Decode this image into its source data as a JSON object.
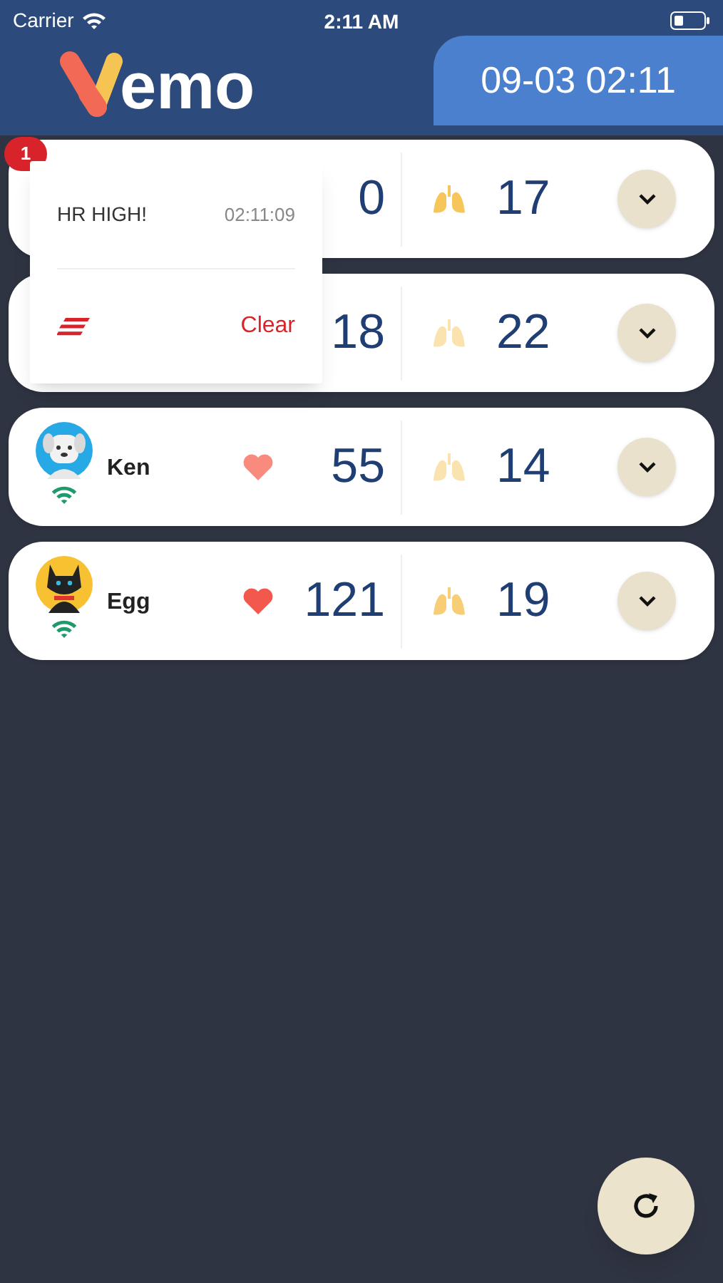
{
  "status_bar": {
    "carrier": "Carrier",
    "time": "2:11 AM"
  },
  "header": {
    "logo_text": "emo",
    "datetime": "09-03 02:11"
  },
  "patients": [
    {
      "hr": "0",
      "rr": "17",
      "lungs": {
        "color": "#f7c65a"
      }
    },
    {
      "hr": "18",
      "rr": "22",
      "lungs": {
        "color": "#fbe3b0"
      }
    },
    {
      "name": "Ken",
      "avatar": {
        "kind": "dog"
      },
      "hr": "55",
      "rr": "14",
      "heart": {
        "color": "#f98a7e"
      },
      "lungs": {
        "color": "#fbe3b0"
      }
    },
    {
      "name": "Egg",
      "avatar": {
        "kind": "cat"
      },
      "hr": "121",
      "rr": "19",
      "heart": {
        "color": "#f2584c"
      },
      "lungs": {
        "color": "#f7cd75"
      }
    }
  ],
  "alert_badge": {
    "count": "1"
  },
  "alert_popup": {
    "message": "HR HIGH!",
    "time": "02:11:09",
    "clear_label": "Clear"
  }
}
